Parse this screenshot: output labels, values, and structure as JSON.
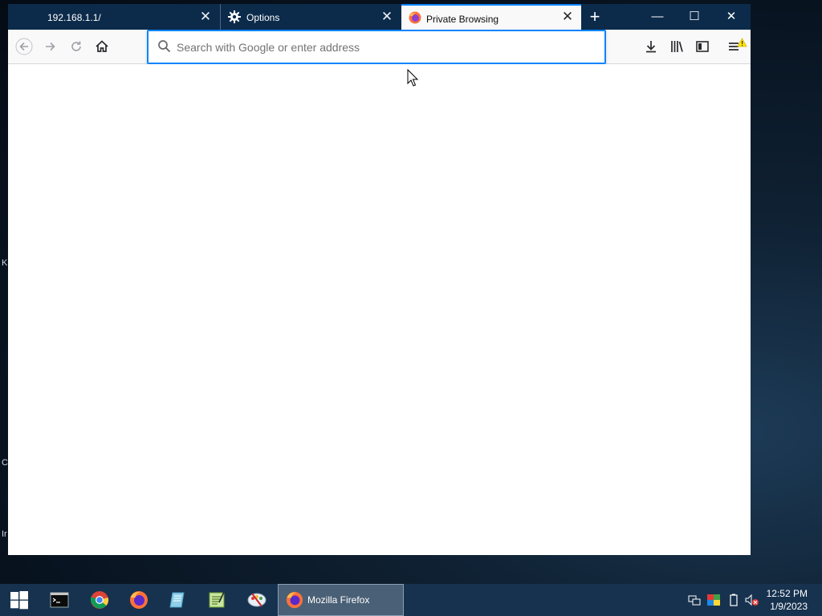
{
  "desktop": {
    "fragments": [
      "K",
      "C",
      "Ir"
    ]
  },
  "browser": {
    "tabs": [
      {
        "label": "192.168.1.1/",
        "icon": "none",
        "active": false
      },
      {
        "label": "Options",
        "icon": "gear-icon",
        "active": false
      },
      {
        "label": "Private Browsing",
        "icon": "firefox-icon",
        "active": true
      }
    ],
    "urlbar": {
      "value": "",
      "placeholder": "Search with Google or enter address"
    },
    "toolbar": {
      "back": "arrow-left-icon",
      "forward": "arrow-right-icon",
      "reload": "reload-icon",
      "home": "home-icon",
      "downloads": "download-icon",
      "library": "library-icon",
      "sidebar": "sidebar-icon",
      "menu": "hamburger-menu-icon"
    },
    "colors": {
      "tabbar": "#0c2b4b",
      "accent": "#0a84ff",
      "warning": "#ffe900"
    }
  },
  "taskbar": {
    "task_label": "Mozilla Firefox",
    "pinned": [
      "windows-start-icon",
      "terminal-icon",
      "chrome-icon",
      "firefox-icon",
      "file-manager-icon",
      "text-editor-icon",
      "paint-icon"
    ],
    "tray": [
      "network-icon",
      "color-icon",
      "battery-icon",
      "volume-muted-icon"
    ],
    "clock": {
      "time": "12:52 PM",
      "date": "1/9/2023"
    }
  }
}
